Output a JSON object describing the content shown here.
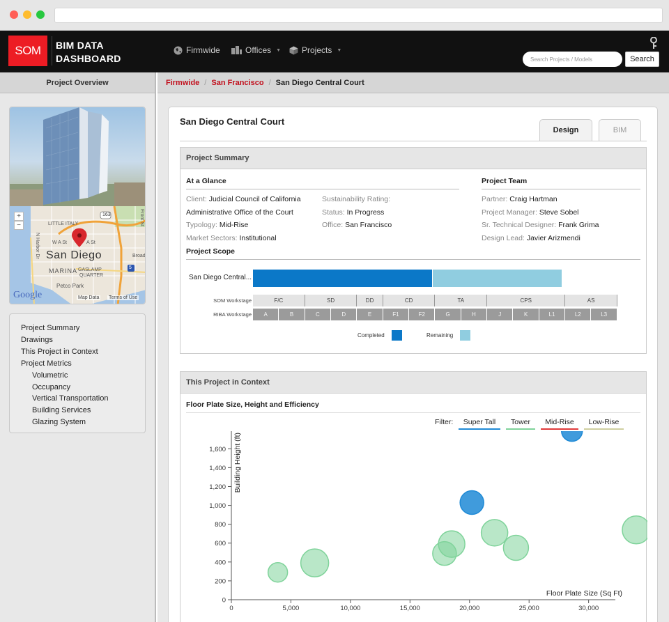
{
  "app": {
    "logo": "SOM",
    "title": "BIM DATA DASHBOARD",
    "nav": [
      {
        "label": "Firmwide",
        "icon": "globe-icon"
      },
      {
        "label": "Offices",
        "icon": "buildings-icon"
      },
      {
        "label": "Projects",
        "icon": "cube-icon"
      }
    ],
    "search": {
      "placeholder": "Search Projects / Models",
      "button": "Search"
    }
  },
  "sidebar": {
    "heading": "Project Overview",
    "map": {
      "city": "San Diego",
      "labels": [
        "LITTLE ITALY",
        "W A St",
        "A St",
        "MARINA",
        "GASLAMP",
        "QUARTER",
        "Petco Park",
        "Broad",
        "Front St",
        "N Harbor Dr"
      ],
      "shields": [
        "163",
        "5"
      ],
      "footer": [
        "Map Data",
        "Terms of Use"
      ],
      "attribution": "Google"
    },
    "links": [
      {
        "label": "Project Summary",
        "level": 1
      },
      {
        "label": "Drawings",
        "level": 1
      },
      {
        "label": "This Project in Context",
        "level": 1
      },
      {
        "label": "Project Metrics",
        "level": 1
      },
      {
        "label": "Volumetric",
        "level": 2
      },
      {
        "label": "Occupancy",
        "level": 2
      },
      {
        "label": "Vertical Transportation",
        "level": 2
      },
      {
        "label": "Building Services",
        "level": 2
      },
      {
        "label": "Glazing System",
        "level": 2
      }
    ]
  },
  "breadcrumb": [
    "Firmwide",
    "San Francisco",
    "San Diego Central Court"
  ],
  "project": {
    "title": "San Diego Central Court",
    "tabs": [
      "Design",
      "BIM"
    ],
    "active_tab": "Design"
  },
  "summary": {
    "heading": "Project Summary",
    "glance_title": "At a Glance",
    "team_title": "Project Team",
    "client_key": "Client:",
    "client_val": "Judicial Council of California",
    "client_val2": "Administrative Office of the Court",
    "typology_key": "Typology:",
    "typology_val": "Mid-Rise",
    "sectors_key": "Market Sectors:",
    "sectors_val": "Institutional",
    "sust_key": "Sustainability Rating:",
    "sust_val": "",
    "status_key": "Status:",
    "status_val": "In Progress",
    "office_key": "Office:",
    "office_val": "San Francisco",
    "partner_key": "Partner:",
    "partner_val": "Craig Hartman",
    "pm_key": "Project Manager:",
    "pm_val": "Steve Sobel",
    "std_key": "Sr. Technical Designer:",
    "std_val": "Frank Grima",
    "lead_key": "Design Lead:",
    "lead_val": "Javier Arizmendi",
    "scope_title": "Project Scope",
    "scope_bar_label": "San Diego Central...",
    "scope_completed_fraction": 0.58,
    "som_label": "SOM Workstage",
    "riba_label": "RIBA Workstage",
    "som_stages": [
      {
        "label": "F/C",
        "span": 2
      },
      {
        "label": "SD",
        "span": 2
      },
      {
        "label": "DD",
        "span": 1
      },
      {
        "label": "CD",
        "span": 2
      },
      {
        "label": "TA",
        "span": 2
      },
      {
        "label": "CPS",
        "span": 3
      },
      {
        "label": "AS",
        "span": 2
      }
    ],
    "riba_stages": [
      "A",
      "B",
      "C",
      "D",
      "E",
      "F1",
      "F2",
      "G",
      "H",
      "J",
      "K",
      "L1",
      "L2",
      "L3"
    ],
    "legend_completed": "Completed",
    "legend_remaining": "Remaining",
    "colors": {
      "completed": "#0b78c8",
      "remaining": "#90cde0"
    }
  },
  "context": {
    "heading": "This Project in Context",
    "chart_title": "Floor Plate Size, Height and Efficiency",
    "filter_label": "Filter:",
    "filters": [
      {
        "label": "Super Tall",
        "color": "#1f8ad6"
      },
      {
        "label": "Tower",
        "color": "#7fd39a"
      },
      {
        "label": "Mid-Rise",
        "color": "#e03a3a"
      },
      {
        "label": "Low-Rise",
        "color": "#cfcfa0"
      }
    ]
  },
  "chart_data": {
    "type": "scatter",
    "xlabel": "Floor Plate Size (Sq Ft)",
    "ylabel": "Building Height (ft)",
    "xlim": [
      0,
      34000
    ],
    "ylim": [
      0,
      1750
    ],
    "xticks": [
      0,
      5000,
      10000,
      15000,
      20000,
      25000,
      30000
    ],
    "yticks": [
      0,
      200,
      400,
      600,
      800,
      1000,
      1200,
      1400,
      1600
    ],
    "series": [
      {
        "name": "Super Tall",
        "color": "#1f8ad6",
        "points": [
          {
            "x": 20200,
            "y": 1030,
            "r": 17
          },
          {
            "x": 28600,
            "y": 1790,
            "r": 15
          }
        ]
      },
      {
        "name": "Tower",
        "color": "#7fd39a",
        "points": [
          {
            "x": 3900,
            "y": 290,
            "r": 14
          },
          {
            "x": 7000,
            "y": 390,
            "r": 20
          },
          {
            "x": 17900,
            "y": 490,
            "r": 17
          },
          {
            "x": 18500,
            "y": 590,
            "r": 19
          },
          {
            "x": 22100,
            "y": 710,
            "r": 19
          },
          {
            "x": 23900,
            "y": 550,
            "r": 18
          },
          {
            "x": 34000,
            "y": 740,
            "r": 20
          }
        ]
      }
    ]
  }
}
